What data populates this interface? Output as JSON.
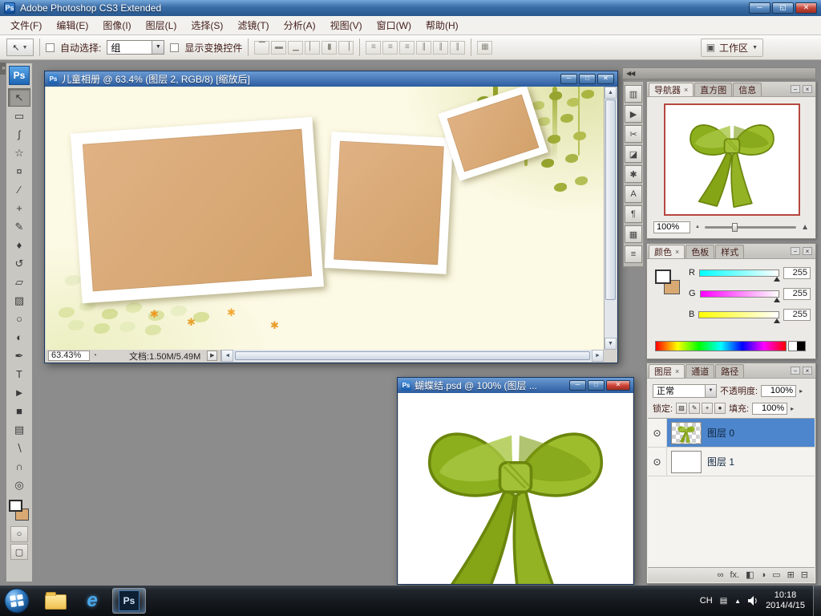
{
  "titlebar": {
    "app_icon": "Ps",
    "title": "Adobe Photoshop CS3 Extended"
  },
  "icons": {
    "min_glyph": "─",
    "max_glyph": "□",
    "restore_glyph": "◱",
    "close_glyph": "✕",
    "panel_minimize": "−",
    "panel_close": "×",
    "eye": "⊙",
    "left_expand": "»",
    "dock_collapse": "◀◀",
    "zoom_out_small": "▲",
    "zoom_in_large": "▲",
    "scroll_up": "▲",
    "scroll_down": "▼",
    "scroll_left": "◄",
    "scroll_right": "►",
    "status_play": "▶",
    "status_clock": "◔",
    "dropdown_arrow": "▼",
    "spin_arrow": "▸"
  },
  "menubar": {
    "items": [
      "文件(F)",
      "编辑(E)",
      "图像(I)",
      "图层(L)",
      "选择(S)",
      "滤镜(T)",
      "分析(A)",
      "视图(V)",
      "窗口(W)",
      "帮助(H)"
    ]
  },
  "options": {
    "tool_preset_glyph": "↖",
    "auto_select_label": "自动选择:",
    "auto_select_value": "组",
    "show_transform_label": "显示变换控件",
    "align_group_a": [
      {
        "name": "align-top-edges-icon",
        "glyph": "▔"
      },
      {
        "name": "align-vertical-centers-icon",
        "glyph": "▬"
      },
      {
        "name": "align-bottom-edges-icon",
        "glyph": "▁"
      },
      {
        "name": "align-left-edges-icon",
        "glyph": "▏"
      },
      {
        "name": "align-horizontal-centers-icon",
        "glyph": "▮"
      },
      {
        "name": "align-right-edges-icon",
        "glyph": "▕"
      }
    ],
    "align_group_b": [
      {
        "name": "distribute-top-edges-icon",
        "glyph": "≡"
      },
      {
        "name": "distribute-vertical-centers-icon",
        "glyph": "≡"
      },
      {
        "name": "distribute-bottom-edges-icon",
        "glyph": "≡"
      },
      {
        "name": "distribute-left-edges-icon",
        "glyph": "∥"
      },
      {
        "name": "distribute-horizontal-centers-icon",
        "glyph": "∥"
      },
      {
        "name": "distribute-right-edges-icon",
        "glyph": "∥"
      }
    ],
    "auto_align": {
      "glyph": "▦"
    },
    "workspace": {
      "icon": "▣",
      "label": "工作区",
      "arrow": "▼"
    }
  },
  "toolbox": {
    "logo": "Ps",
    "colors": {
      "foreground": "#ffffff",
      "background": "#d9a973"
    },
    "tools": [
      {
        "name": "move-tool",
        "glyph": "↖",
        "selected": true
      },
      {
        "name": "marquee-tool",
        "glyph": "▭"
      },
      {
        "name": "lasso-tool",
        "glyph": "ʃ"
      },
      {
        "name": "magic-wand-tool",
        "glyph": "☆"
      },
      {
        "name": "crop-tool",
        "glyph": "¤"
      },
      {
        "name": "slice-tool",
        "glyph": "∕"
      },
      {
        "name": "healing-brush-tool",
        "glyph": "+"
      },
      {
        "name": "brush-tool",
        "glyph": "✎"
      },
      {
        "name": "clone-stamp-tool",
        "glyph": "♦"
      },
      {
        "name": "history-brush-tool",
        "glyph": "↺"
      },
      {
        "name": "eraser-tool",
        "glyph": "▱"
      },
      {
        "name": "gradient-tool",
        "glyph": "▨"
      },
      {
        "name": "blur-tool",
        "glyph": "○"
      },
      {
        "name": "dodge-tool",
        "glyph": "◐"
      },
      {
        "name": "pen-tool",
        "glyph": "✒"
      },
      {
        "name": "type-tool",
        "glyph": "T"
      },
      {
        "name": "path-selection-tool",
        "glyph": "►"
      },
      {
        "name": "shape-tool",
        "glyph": "■"
      },
      {
        "name": "notes-tool",
        "glyph": "▤"
      },
      {
        "name": "eyedropper-tool",
        "glyph": "∖"
      },
      {
        "name": "hand-tool",
        "glyph": "∩"
      },
      {
        "name": "zoom-tool",
        "glyph": "◎"
      }
    ]
  },
  "doc1": {
    "icon": "Ps",
    "title": "儿童相册 @ 63.4% (图层 2, RGB/8) [缩放后]",
    "zoom": "63.43%",
    "doc_info": "文档:1.50M/5.49M"
  },
  "doc2": {
    "icon": "Ps",
    "title": "蝴蝶结.psd @ 100% (图层 ..."
  },
  "dock": {
    "icons": [
      {
        "name": "history-panel-icon",
        "glyph": "▥"
      },
      {
        "name": "actions-panel-icon",
        "glyph": "▶"
      },
      {
        "name": "tool-presets-panel-icon",
        "glyph": "✂"
      },
      {
        "name": "clone-source-panel-icon",
        "glyph": "◪"
      },
      {
        "name": "brushes-panel-icon",
        "glyph": "✱"
      },
      {
        "name": "character-panel-icon",
        "glyph": "A"
      },
      {
        "name": "paragraph-panel-icon",
        "glyph": "¶"
      },
      {
        "name": "layer-comps-panel-icon",
        "glyph": "▦"
      },
      {
        "name": "info-panel-icon",
        "glyph": "≡"
      }
    ]
  },
  "navigator": {
    "tabs": [
      "导航器",
      "直方图",
      "信息"
    ],
    "zoom": "100%"
  },
  "color_panel": {
    "tabs": [
      "颜色",
      "色板",
      "样式"
    ],
    "foreground": "#ffffff",
    "background": "#d9a973",
    "channels": [
      {
        "label": "R",
        "value": "255"
      },
      {
        "label": "G",
        "value": "255"
      },
      {
        "label": "B",
        "value": "255"
      }
    ]
  },
  "layers_panel": {
    "tabs": [
      "图层",
      "通道",
      "路径"
    ],
    "blend_mode": "正常",
    "opacity_label": "不透明度:",
    "opacity_value": "100%",
    "lock_label": "锁定:",
    "fill_label": "填充:",
    "fill_value": "100%",
    "lock_icons": [
      {
        "name": "lock-transparency-icon",
        "glyph": "▨"
      },
      {
        "name": "lock-pixels-icon",
        "glyph": "✎"
      },
      {
        "name": "lock-position-icon",
        "glyph": "+"
      },
      {
        "name": "lock-all-icon",
        "glyph": "●"
      }
    ],
    "items": [
      {
        "name": "图层 0",
        "selected": true
      },
      {
        "name": "图层 1",
        "selected": false
      }
    ],
    "footer_icons": [
      {
        "name": "link-layers-icon",
        "glyph": "∞"
      },
      {
        "name": "layer-style-icon",
        "glyph": "fx."
      },
      {
        "name": "layer-mask-icon",
        "glyph": "◧"
      },
      {
        "name": "adjustment-layer-icon",
        "glyph": "◑"
      },
      {
        "name": "layer-group-icon",
        "glyph": "▭"
      },
      {
        "name": "new-layer-icon",
        "glyph": "⊞"
      },
      {
        "name": "delete-layer-icon",
        "glyph": "⊟"
      }
    ]
  },
  "taskbar": {
    "ps_label": "Ps",
    "ie_glyph": "e",
    "lang": "CH",
    "ime_icon": "▤",
    "time": "10:18",
    "date": "2014/4/15"
  }
}
